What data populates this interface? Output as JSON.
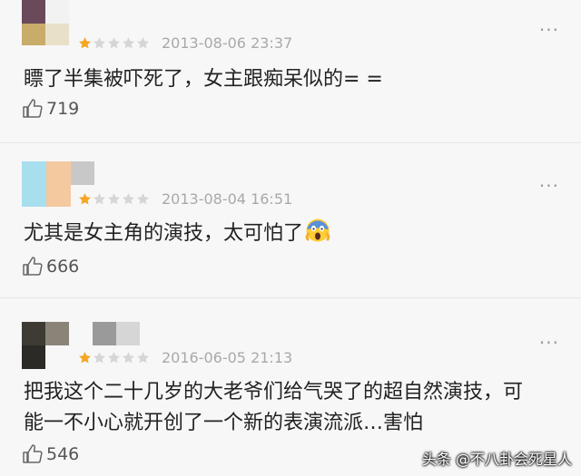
{
  "comments": [
    {
      "rating": 1,
      "max_rating": 5,
      "date": "2013-08-06 23:37",
      "text": "瞟了半集被吓死了，女主跟痴呆似的= =",
      "likes": "719",
      "more_label": "..."
    },
    {
      "rating": 1,
      "max_rating": 5,
      "date": "2013-08-04 16:51",
      "text": "尤其是女主角的演技，太可怕了",
      "emoji": "scream-face",
      "likes": "666",
      "more_label": "..."
    },
    {
      "rating": 1,
      "max_rating": 5,
      "date": "2016-06-05 21:13",
      "text_line1": "把我这个二十几岁的大老爷们给气哭了的超自然演技，可",
      "text_line2": "能一不小心就开创了一个新的表演流派…害怕",
      "likes": "546",
      "more_label": "..."
    }
  ],
  "watermark": "头条 @不八卦会死星人",
  "colors": {
    "star_filled": "#f5a623",
    "star_empty": "#d6d6d6",
    "text": "#222222",
    "meta": "#a9a9a9"
  },
  "icons": {
    "rating": "star-icon",
    "like": "thumbs-up-icon",
    "more": "more-dots-icon"
  }
}
